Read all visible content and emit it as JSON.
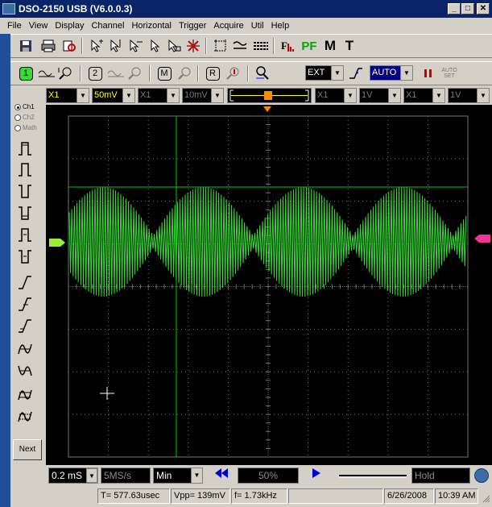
{
  "window": {
    "title": "DSO-2150 USB (V6.0.0.3)"
  },
  "menu": [
    "File",
    "View",
    "Display",
    "Channel",
    "Horizontal",
    "Trigger",
    "Acquire",
    "Util",
    "Help"
  ],
  "toolbar1": {
    "pf_label": "PF",
    "m_label": "M",
    "t_label": "T"
  },
  "toolbar2": {
    "ch1_label": "1",
    "ch2_label": "2",
    "math_label": "M",
    "ref_label": "R",
    "trigger_source": "EXT",
    "trigger_mode": "AUTO",
    "autoset_label": "AUTO SET"
  },
  "channel_settings": {
    "ch1_probe": "X1",
    "ch1_volts": "50mV",
    "ch2_probe": "X1",
    "ch2_volts": "10mV",
    "math_probe": "X1",
    "math_volts": "1V",
    "ref_probe": "X1",
    "ref_volts": "1V"
  },
  "side_panel": {
    "channels": [
      "Ch1",
      "Ch2",
      "Math"
    ],
    "next_label": "Next"
  },
  "timebase": {
    "time_div": "0.2 mS",
    "sample_rate": "5MS/s",
    "mode": "Min",
    "position": "50%",
    "run_state": "Hold"
  },
  "status": {
    "cursor_time": "T= 577.63usec",
    "vpp": "Vpp= 139mV",
    "frequency": "f= 1.73kHz",
    "date": "6/26/2008",
    "time": "10:39 AM"
  },
  "colors": {
    "trace": "#33dd33",
    "grid": "#6a7a6a",
    "cursor": "#00cc00",
    "trigger_marker": "#ff8800",
    "ch1_marker": "#99ee33",
    "ref_marker": "#ee3399"
  }
}
